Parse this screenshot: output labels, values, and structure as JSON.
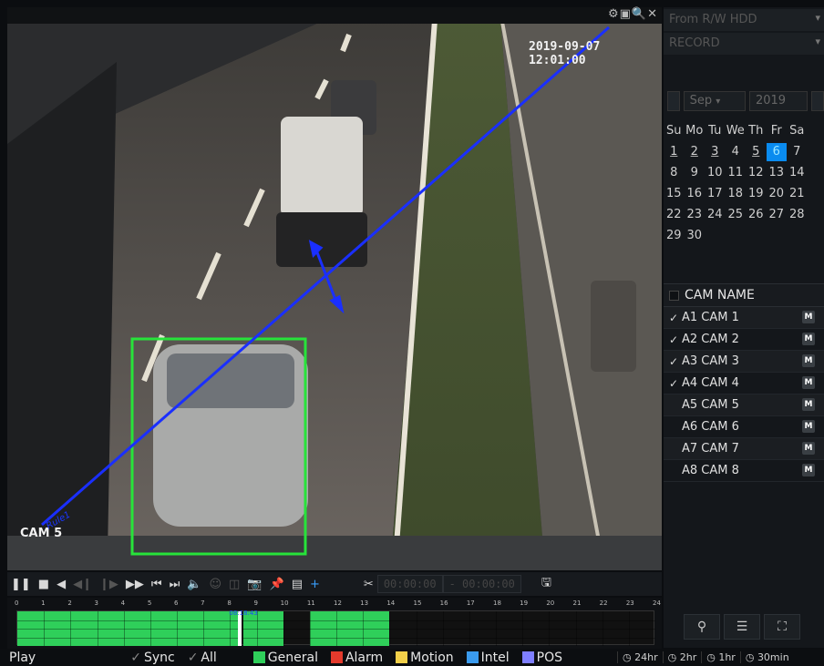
{
  "video": {
    "timestamp": "2019-09-07 12:01:00",
    "camera_label": "CAM 5",
    "rule_label": "Rule1",
    "icons": [
      "settings-icon",
      "snapshot-icon",
      "zoom-icon",
      "close-icon"
    ]
  },
  "right_panel": {
    "source": "From R/W HDD",
    "mode": "RECORD",
    "month": "Sep",
    "year": "2019",
    "weekdays": [
      "Su",
      "Mo",
      "Tu",
      "We",
      "Th",
      "Fr",
      "Sa"
    ],
    "weeks": [
      [
        "1",
        "2",
        "3",
        "4",
        "5",
        "6",
        "7"
      ],
      [
        "8",
        "9",
        "10",
        "11",
        "12",
        "13",
        "14"
      ],
      [
        "15",
        "16",
        "17",
        "18",
        "19",
        "20",
        "21"
      ],
      [
        "22",
        "23",
        "24",
        "25",
        "26",
        "27",
        "28"
      ],
      [
        "29",
        "30",
        "",
        "",
        "",
        "",
        ""
      ]
    ],
    "selected_day": "6",
    "cam_header": "CAM NAME",
    "cameras": [
      {
        "name": "A1 CAM 1",
        "checked": true
      },
      {
        "name": "A2 CAM 2",
        "checked": true
      },
      {
        "name": "A3 CAM 3",
        "checked": true
      },
      {
        "name": "A4 CAM 4",
        "checked": true
      },
      {
        "name": "A5 CAM 5",
        "checked": false
      },
      {
        "name": "A6 CAM 6",
        "checked": false
      },
      {
        "name": "A7 CAM 7",
        "checked": false
      },
      {
        "name": "A8 CAM 8",
        "checked": false
      }
    ],
    "badge": "M"
  },
  "controls": {
    "start_time": "00:00:00",
    "end_time": "- 00:00:00"
  },
  "timeline": {
    "hours": [
      "0",
      "1",
      "2",
      "3",
      "4",
      "5",
      "6",
      "7",
      "8",
      "9",
      "10",
      "11",
      "12",
      "13",
      "14",
      "15",
      "16",
      "17",
      "18",
      "19",
      "20",
      "21",
      "22",
      "23",
      "24"
    ],
    "cursor_label": "08:18:43",
    "recorded_ranges": [
      [
        0,
        8.3
      ],
      [
        8.5,
        10
      ],
      [
        11,
        14
      ]
    ]
  },
  "status": {
    "mode": "Play",
    "sync": "Sync",
    "all": "All",
    "general": "General",
    "alarm": "Alarm",
    "motion": "Motion",
    "intel": "Intel",
    "pos": "POS",
    "zoom_24": "24hr",
    "zoom_2": "2hr",
    "zoom_1": "1hr",
    "zoom_30": "30min",
    "colors": {
      "general": "#2fcf5a",
      "alarm": "#e33a2c",
      "motion": "#f2d04a",
      "intel": "#3a9bef",
      "pos": "#7f7fff"
    }
  }
}
